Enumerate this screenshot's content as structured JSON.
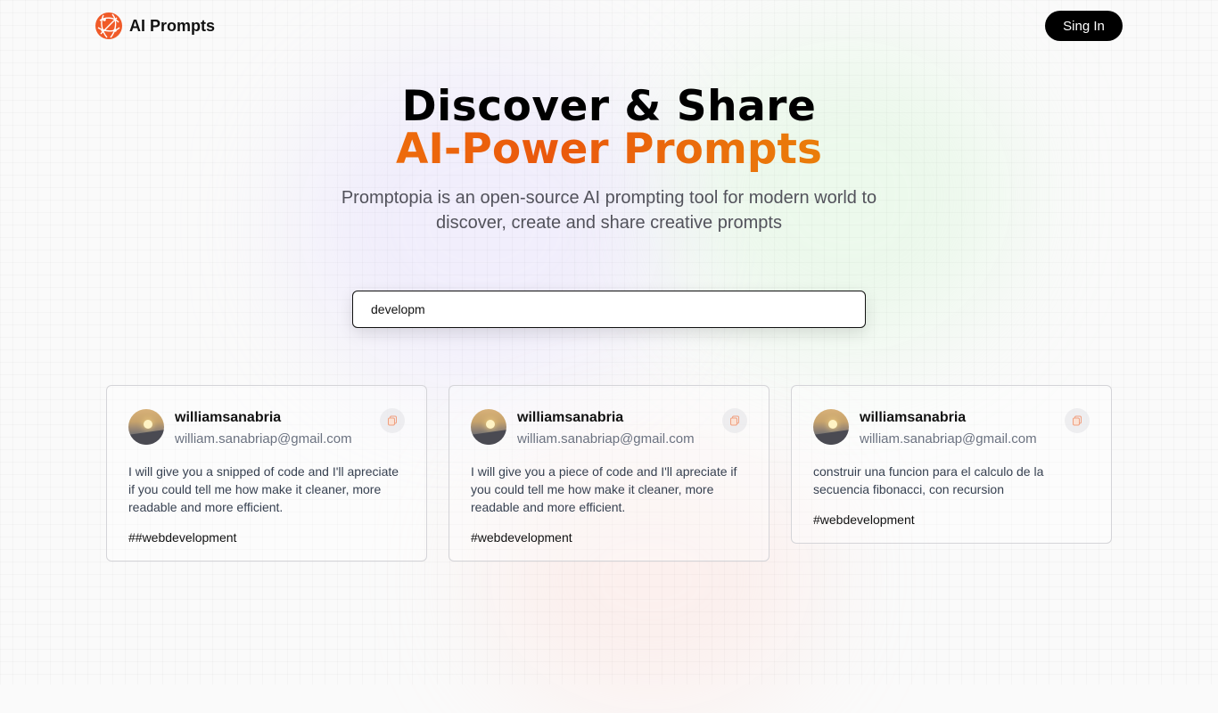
{
  "header": {
    "brand": "AI Prompts",
    "signin_label": "Sing In"
  },
  "hero": {
    "title_line1": "Discover & Share",
    "title_line2": "AI-Power Prompts",
    "description": "Promptopia is an open-source AI prompting tool for modern world to discover, create and share creative prompts"
  },
  "search": {
    "value": "developm"
  },
  "cards": [
    {
      "username": "williamsanabria",
      "email": "william.sanabriap@gmail.com",
      "prompt": "I will give you a snipped of code and I'll apreciate if you could tell me how make it cleaner, more readable and more efficient.",
      "tag": "##webdevelopment"
    },
    {
      "username": "williamsanabria",
      "email": "william.sanabriap@gmail.com",
      "prompt": "I will give you a piece of code and I'll apreciate if you could tell me how make it cleaner, more readable and more efficient.",
      "tag": "#webdevelopment"
    },
    {
      "username": "williamsanabria",
      "email": "william.sanabriap@gmail.com",
      "prompt": "construir una funcion para el calculo de la secuencia fibonacci, con recursion",
      "tag": "#webdevelopment"
    }
  ],
  "icons": {
    "logo": "globe-logo-icon",
    "copy": "copy-icon"
  },
  "colors": {
    "accent": "#ea580c",
    "button": "#000000"
  }
}
